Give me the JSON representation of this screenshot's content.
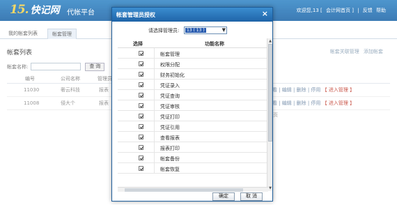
{
  "header": {
    "logo_mark": "15.",
    "logo_text": "快记网",
    "platform_title": "代帐平台",
    "links": [
      "欢迎您,13 [",
      "会计网首页 ]",
      "|",
      "反馈",
      "帮助"
    ]
  },
  "tabs": [
    {
      "label": "我的帐套列表"
    },
    {
      "label": "帐套管理"
    }
  ],
  "page": {
    "section_title": "帐套列表",
    "right_actions": [
      "帐套关联管理",
      "添加帐套"
    ],
    "search_label": "帐套名称:",
    "search_value": "",
    "search_button": "查 询"
  },
  "table": {
    "headers": [
      "编号",
      "公司名称",
      "管理员"
    ],
    "rows": [
      {
        "no": "11030",
        "company": "奢云科技",
        "admin": "报表",
        "ops": "查看 | 编辑 | 删除 | 停用",
        "enter": "【 进入管理 】"
      },
      {
        "no": "11008",
        "company": "侵大个",
        "admin": "报表",
        "ops": "查看 | 编辑 | 删除 | 停用",
        "enter": "【 进入管理 】"
      }
    ],
    "trailing_fragment": "页"
  },
  "dialog": {
    "title": "帐套管理员授权",
    "close_label": "×",
    "admin_label": "请选择管理员:",
    "admin_selected": "13 ( 13 )",
    "columns": [
      "选择",
      "功能名称"
    ],
    "permissions": [
      "帐套管理",
      "权限分配",
      "财务初始化",
      "凭证录入",
      "凭证查询",
      "凭证审核",
      "凭证打印",
      "凭证引用",
      "查看报表",
      "报表打印",
      "帐套备份",
      "帐套恢复"
    ],
    "ok_label": "确定",
    "cancel_label": "取 消"
  }
}
